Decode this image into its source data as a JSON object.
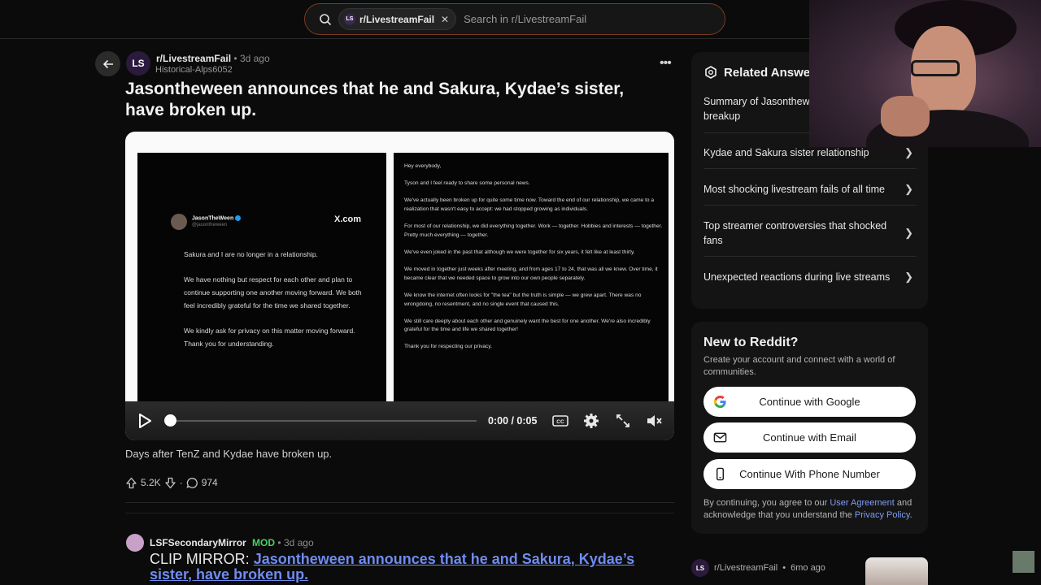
{
  "search": {
    "chip_label": "r/LivestreamFail",
    "chip_icon_text": "LS",
    "placeholder": "Search in r/LivestreamFail"
  },
  "post": {
    "avatar_text": "LS",
    "subreddit": "r/LivestreamFail",
    "dot": "•",
    "time": "3d ago",
    "author": "Historical-Alps6052",
    "title": "Jasontheween announces that he and Sakura, Kydae’s sister, have broken up.",
    "description": "Days after TenZ and Kydae have broken up.",
    "upvotes": "5.2K",
    "comments": "974"
  },
  "tweet": {
    "name": "JasonTheWeen",
    "handle": "@jasontheween",
    "source": "X.com",
    "paragraphs": [
      "Sakura and I are no longer in a relationship.",
      "We have nothing but respect for each other and plan to continue supporting one another moving forward. We both feel incredibly grateful for the time we shared together.",
      "We kindly ask for privacy on this matter moving forward. Thank you for understanding."
    ]
  },
  "letter": {
    "paragraphs": [
      "Hey everybody,",
      "Tyson and I feel ready to share some personal news.",
      "We've actually been broken up for quite some time now. Toward the end of our relationship, we came to a realization that wasn't easy to accept: we had stopped growing as individuals.",
      "For most of our relationship, we did everything together. Work — together. Hobbies and interests — together. Pretty much everything — together.",
      "We've even joked in the past that although we were together for six years, it felt like at least thirty.",
      "We moved in together just weeks after meeting, and from ages 17 to 24, that was all we knew. Over time, it became clear that we needed space to grow into our own people separately.",
      "We know the internet often looks for \"the tea\" but the truth is simple — we grew apart. There was no wrongdoing, no resentment, and no single event that caused this.",
      "We still care deeply about each other and genuinely want the best for one another. We're also incredibly grateful for the time and life we shared together!",
      "Thank you for respecting our privacy."
    ]
  },
  "video": {
    "time": "0:00 / 0:05",
    "progress": 0
  },
  "comment": {
    "user": "LSFSecondaryMirror",
    "badge": "MOD",
    "dot": "•",
    "time": "3d ago",
    "prefix": "CLIP MIRROR: ",
    "link": "Jasontheween announces that he and Sakura, Kydae’s sister, have broken up."
  },
  "related": {
    "title": "Related Answers",
    "items": [
      "Summary of Jasontheween and Sakura breakup",
      "Kydae and Sakura sister relationship",
      "Most shocking livestream fails of all time",
      "Top streamer controversies that shocked fans",
      "Unexpected reactions during live streams"
    ]
  },
  "new_to_reddit": {
    "title": "New to Reddit?",
    "subtitle": "Create your account and connect with a world of communities.",
    "google": "Continue with Google",
    "email": "Continue with Email",
    "phone": "Continue With Phone Number",
    "legal_prefix": "By continuing, you agree to our ",
    "user_agreement": "User Agreement",
    "legal_mid": " and acknowledge that you understand the ",
    "privacy_policy": "Privacy Policy",
    "legal_suffix": "."
  },
  "sidebar_bottom": {
    "avatar_text": "LS",
    "subreddit": "r/LivestreamFail",
    "dot": "•",
    "time": "6mo ago"
  },
  "colors": {
    "accent_link": "#6f8cf0",
    "mod_green": "#46d160",
    "search_border": "#7a3a20"
  }
}
